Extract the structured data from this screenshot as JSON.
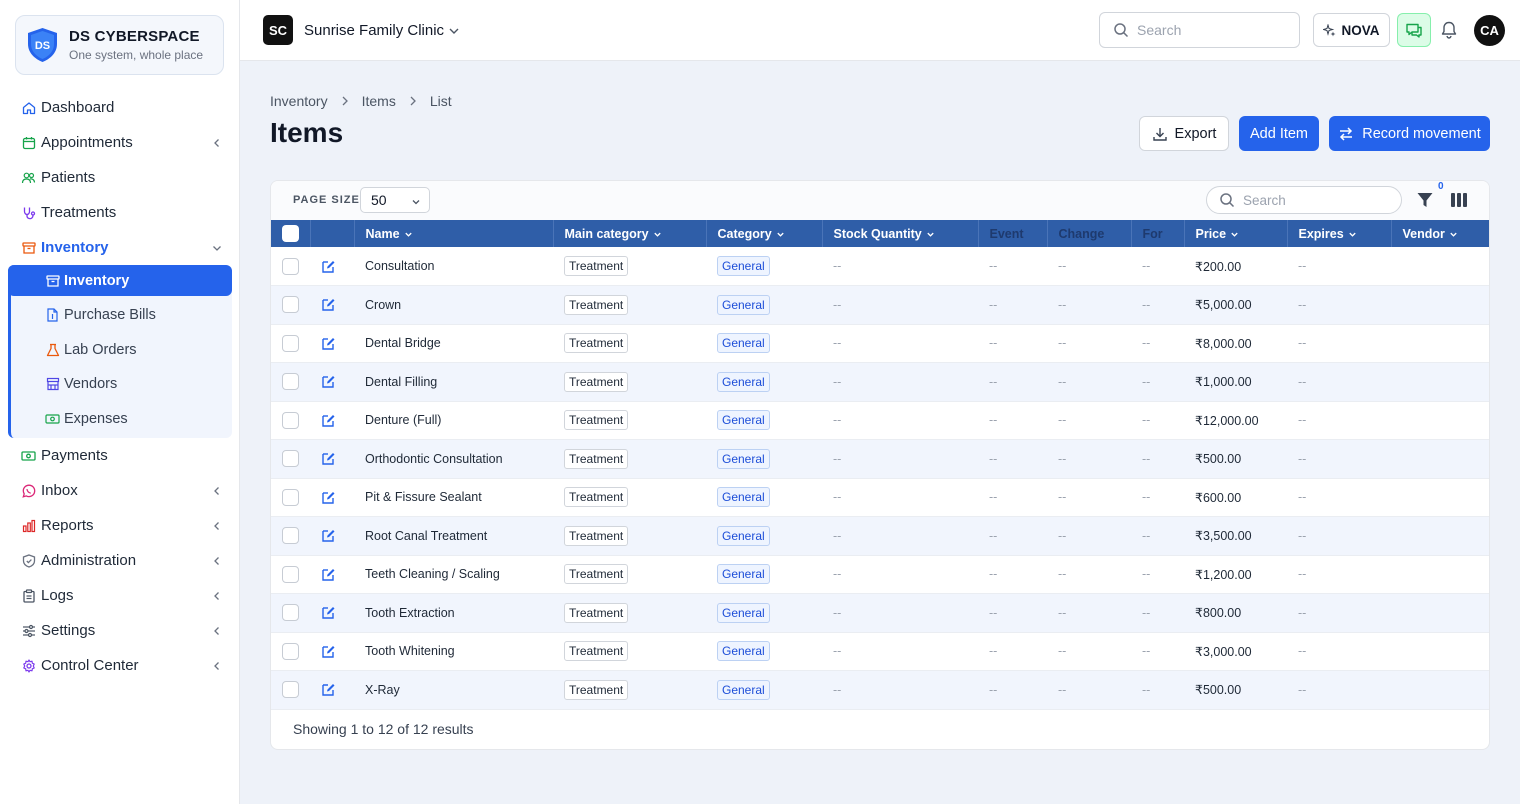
{
  "brand": {
    "name": "DS CYBERSPACE",
    "tagline": "One system, whole place",
    "logo_letters": "DS"
  },
  "nav": {
    "items": [
      {
        "label": "Dashboard",
        "icon": "home-icon"
      },
      {
        "label": "Appointments",
        "icon": "calendar-icon"
      },
      {
        "label": "Patients",
        "icon": "users-icon"
      },
      {
        "label": "Treatments",
        "icon": "stethoscope-icon"
      },
      {
        "label": "Inventory",
        "icon": "archive-icon"
      },
      {
        "label": "Payments",
        "icon": "money-icon"
      },
      {
        "label": "Inbox",
        "icon": "whatsapp-icon"
      },
      {
        "label": "Reports",
        "icon": "bar-chart-icon"
      },
      {
        "label": "Administration",
        "icon": "shield-icon"
      },
      {
        "label": "Logs",
        "icon": "clipboard-icon"
      },
      {
        "label": "Settings",
        "icon": "sliders-icon"
      },
      {
        "label": "Control Center",
        "icon": "gear-icon"
      }
    ],
    "inventory_sub": [
      {
        "label": "Inventory",
        "icon": "archive-icon"
      },
      {
        "label": "Purchase Bills",
        "icon": "file-icon"
      },
      {
        "label": "Lab Orders",
        "icon": "flask-icon"
      },
      {
        "label": "Vendors",
        "icon": "store-icon"
      },
      {
        "label": "Expenses",
        "icon": "cash-icon"
      }
    ]
  },
  "header": {
    "org_initials": "SC",
    "org_name": "Sunrise Family Clinic",
    "search_placeholder": "Search",
    "nova_label": "NOVA",
    "avatar_initials": "CA"
  },
  "breadcrumb": [
    "Inventory",
    "Items",
    "List"
  ],
  "page_title": "Items",
  "actions": {
    "export": "Export",
    "add": "Add Item",
    "record": "Record movement"
  },
  "table_toolbar": {
    "page_size_label": "PAGE SIZE",
    "page_size": "50",
    "search_placeholder": "Search",
    "filter_count": "0"
  },
  "columns": [
    "Name",
    "Main category",
    "Category",
    "Stock Quantity",
    "Event",
    "Change",
    "For",
    "Price",
    "Expires",
    "Vendor"
  ],
  "rows": [
    {
      "name": "Consultation",
      "main": "Treatment",
      "cat": "General",
      "stock": "--",
      "event": "--",
      "change": "--",
      "for": "--",
      "price": "₹200.00",
      "expires": "--",
      "vendor": ""
    },
    {
      "name": "Crown",
      "main": "Treatment",
      "cat": "General",
      "stock": "--",
      "event": "--",
      "change": "--",
      "for": "--",
      "price": "₹5,000.00",
      "expires": "--",
      "vendor": ""
    },
    {
      "name": "Dental Bridge",
      "main": "Treatment",
      "cat": "General",
      "stock": "--",
      "event": "--",
      "change": "--",
      "for": "--",
      "price": "₹8,000.00",
      "expires": "--",
      "vendor": ""
    },
    {
      "name": "Dental Filling",
      "main": "Treatment",
      "cat": "General",
      "stock": "--",
      "event": "--",
      "change": "--",
      "for": "--",
      "price": "₹1,000.00",
      "expires": "--",
      "vendor": ""
    },
    {
      "name": "Denture (Full)",
      "main": "Treatment",
      "cat": "General",
      "stock": "--",
      "event": "--",
      "change": "--",
      "for": "--",
      "price": "₹12,000.00",
      "expires": "--",
      "vendor": ""
    },
    {
      "name": "Orthodontic Consultation",
      "main": "Treatment",
      "cat": "General",
      "stock": "--",
      "event": "--",
      "change": "--",
      "for": "--",
      "price": "₹500.00",
      "expires": "--",
      "vendor": ""
    },
    {
      "name": "Pit & Fissure Sealant",
      "main": "Treatment",
      "cat": "General",
      "stock": "--",
      "event": "--",
      "change": "--",
      "for": "--",
      "price": "₹600.00",
      "expires": "--",
      "vendor": ""
    },
    {
      "name": "Root Canal Treatment",
      "main": "Treatment",
      "cat": "General",
      "stock": "--",
      "event": "--",
      "change": "--",
      "for": "--",
      "price": "₹3,500.00",
      "expires": "--",
      "vendor": ""
    },
    {
      "name": "Teeth Cleaning / Scaling",
      "main": "Treatment",
      "cat": "General",
      "stock": "--",
      "event": "--",
      "change": "--",
      "for": "--",
      "price": "₹1,200.00",
      "expires": "--",
      "vendor": ""
    },
    {
      "name": "Tooth Extraction",
      "main": "Treatment",
      "cat": "General",
      "stock": "--",
      "event": "--",
      "change": "--",
      "for": "--",
      "price": "₹800.00",
      "expires": "--",
      "vendor": ""
    },
    {
      "name": "Tooth Whitening",
      "main": "Treatment",
      "cat": "General",
      "stock": "--",
      "event": "--",
      "change": "--",
      "for": "--",
      "price": "₹3,000.00",
      "expires": "--",
      "vendor": ""
    },
    {
      "name": "X-Ray",
      "main": "Treatment",
      "cat": "General",
      "stock": "--",
      "event": "--",
      "change": "--",
      "for": "--",
      "price": "₹500.00",
      "expires": "--",
      "vendor": ""
    }
  ],
  "footer": "Showing 1 to 12 of 12 results",
  "colors": {
    "accent": "#2563eb",
    "table_header": "#2f5ea8",
    "chat_bg": "#dcfce7"
  }
}
